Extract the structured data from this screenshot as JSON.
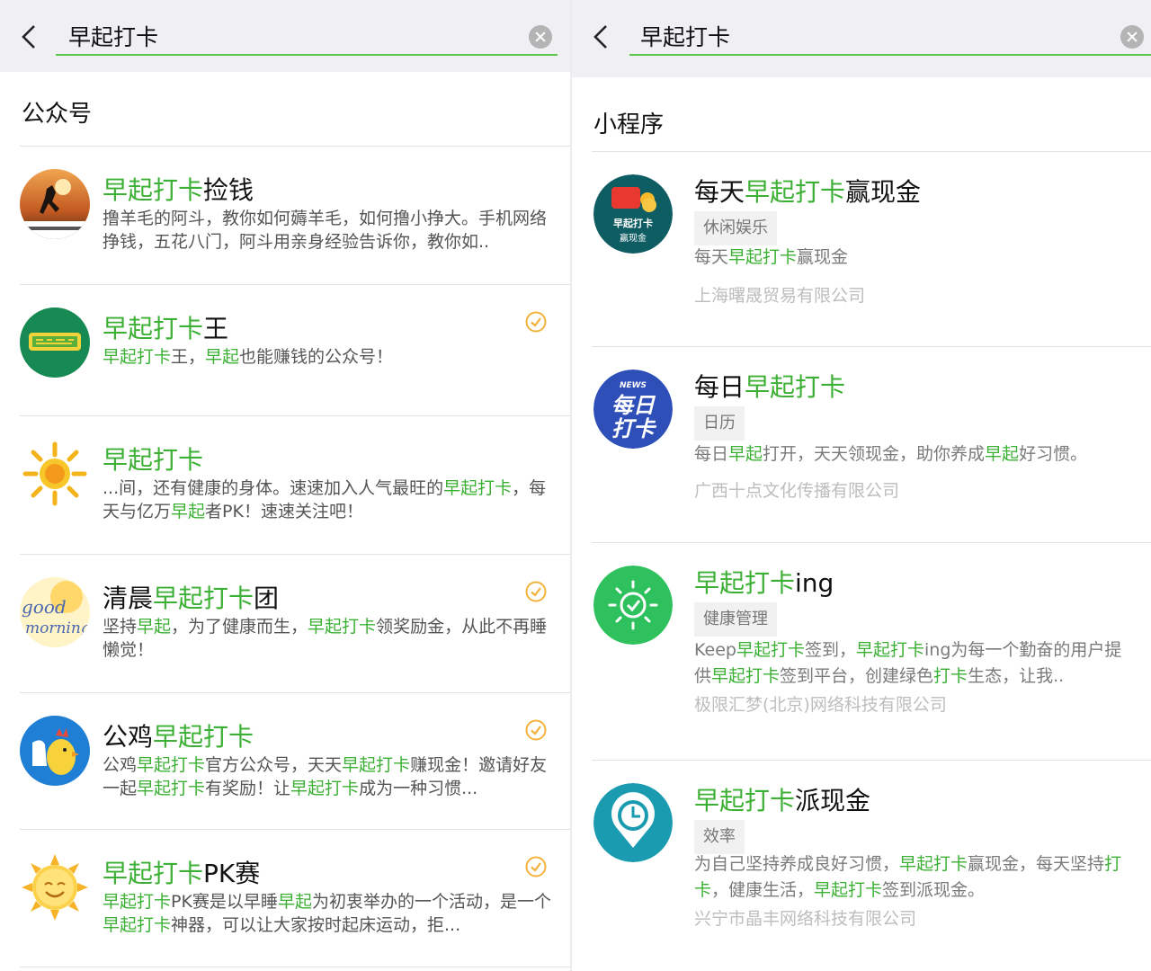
{
  "left": {
    "search": {
      "query": "早起打卡"
    },
    "section_title": "公众号",
    "accounts": [
      {
        "title": [
          [
            "早起打卡",
            "g"
          ],
          [
            "捡钱",
            ""
          ]
        ],
        "desc": [
          [
            "撸羊毛的阿斗，教你如何薅羊毛，如何撸小挣大。手机网络挣钱，五花八门，阿斗用亲身经验告诉你，教你如..",
            ""
          ]
        ],
        "verified": false
      },
      {
        "title": [
          [
            "早起打卡",
            "g"
          ],
          [
            "王",
            ""
          ]
        ],
        "desc": [
          [
            "早起打卡",
            "g"
          ],
          [
            "王，",
            ""
          ],
          [
            "早起",
            "g"
          ],
          [
            "也能赚钱的公众号！",
            ""
          ]
        ],
        "verified": true
      },
      {
        "title": [
          [
            "早起打卡",
            "g"
          ]
        ],
        "desc": [
          [
            "...间，还有健康的身体。速速加入人气最旺的",
            ""
          ],
          [
            "早起打卡",
            "g"
          ],
          [
            "，每天与亿万",
            ""
          ],
          [
            "早起",
            "g"
          ],
          [
            "者PK！速速关注吧！",
            ""
          ]
        ],
        "verified": false
      },
      {
        "title": [
          [
            "清晨",
            ""
          ],
          [
            "早起打卡",
            "g"
          ],
          [
            "团",
            ""
          ]
        ],
        "desc": [
          [
            "坚持",
            ""
          ],
          [
            "早起",
            "g"
          ],
          [
            "，为了健康而生，",
            ""
          ],
          [
            "早起打卡",
            "g"
          ],
          [
            "领奖励金，从此不再睡懒觉！",
            ""
          ]
        ],
        "verified": true
      },
      {
        "title": [
          [
            "公鸡",
            ""
          ],
          [
            "早起打卡",
            "g"
          ]
        ],
        "desc": [
          [
            "公鸡",
            ""
          ],
          [
            "早起打卡",
            "g"
          ],
          [
            "官方公众号，天天",
            ""
          ],
          [
            "早起打卡",
            "g"
          ],
          [
            "赚现金！邀请好友一起",
            ""
          ],
          [
            "早起打卡",
            "g"
          ],
          [
            "有奖励！让",
            ""
          ],
          [
            "早起打卡",
            "g"
          ],
          [
            "成为一种习惯...",
            ""
          ]
        ],
        "verified": true
      },
      {
        "title": [
          [
            "早起打卡",
            "g"
          ],
          [
            "PK赛",
            ""
          ]
        ],
        "desc": [
          [
            "早起打卡",
            "g"
          ],
          [
            "PK赛是以早睡",
            ""
          ],
          [
            "早起",
            "g"
          ],
          [
            "为初衷举办的一个活动，是一个",
            ""
          ],
          [
            "早起打卡",
            "g"
          ],
          [
            "神器，可以让大家按时起床运动，拒...",
            ""
          ]
        ],
        "verified": true
      }
    ]
  },
  "right": {
    "search": {
      "query": "早起打卡"
    },
    "section_title": "小程序",
    "apps": [
      {
        "title": [
          [
            "每天",
            ""
          ],
          [
            "早起打卡",
            "g"
          ],
          [
            "赢现金",
            ""
          ]
        ],
        "tag": "休闲娱乐",
        "desc": [
          [
            "每天",
            ""
          ],
          [
            "早起打卡",
            "g"
          ],
          [
            "赢现金",
            ""
          ]
        ],
        "company": "上海曙晟贸易有限公司",
        "icon_text_1": "早起打卡",
        "icon_text_2": "赢现金"
      },
      {
        "title": [
          [
            "每日",
            ""
          ],
          [
            "早起打卡",
            "g"
          ]
        ],
        "tag": "日历",
        "desc": [
          [
            "每日",
            ""
          ],
          [
            "早起",
            "g"
          ],
          [
            "打开，天天领现金，助你养成",
            ""
          ],
          [
            "早起",
            "g"
          ],
          [
            "好习惯。",
            ""
          ]
        ],
        "company": "广西十点文化传播有限公司",
        "icon_text_1": "NEWS",
        "icon_text_2": "每日打卡"
      },
      {
        "title": [
          [
            "早起打卡",
            "g"
          ],
          [
            "ing",
            ""
          ]
        ],
        "tag": "健康管理",
        "desc": [
          [
            "Keep",
            ""
          ],
          [
            "早起打卡",
            "g"
          ],
          [
            "签到，",
            ""
          ],
          [
            "早起打卡",
            "g"
          ],
          [
            "ing为每一个勤奋的用户提供",
            ""
          ],
          [
            "早起打卡",
            "g"
          ],
          [
            "签到平台，创建绿色",
            ""
          ],
          [
            "打卡",
            "g"
          ],
          [
            "生态，让我..",
            ""
          ]
        ],
        "company": "极限汇梦(北京)网络科技有限公司"
      },
      {
        "title": [
          [
            "早起打卡",
            "g"
          ],
          [
            "派现金",
            ""
          ]
        ],
        "tag": "效率",
        "desc": [
          [
            "为自己坚持养成良好习惯，",
            ""
          ],
          [
            "早起打卡",
            "g"
          ],
          [
            "赢现金，每天坚持",
            ""
          ],
          [
            "打卡",
            "g"
          ],
          [
            "，健康生活，",
            ""
          ],
          [
            "早起打卡",
            "g"
          ],
          [
            "签到派现金。",
            ""
          ]
        ],
        "company": "兴宁市晶丰网络科技有限公司"
      }
    ]
  },
  "colors": {
    "highlight": "#3cb034",
    "search_underline": "#5bc54a",
    "verified": "#f2b33d"
  }
}
